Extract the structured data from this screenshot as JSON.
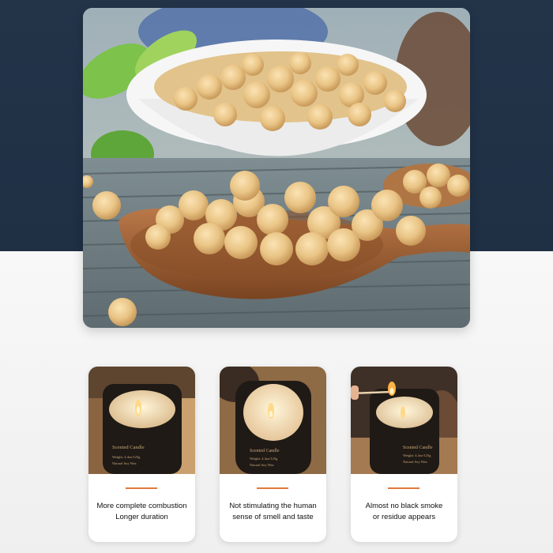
{
  "hero": {
    "image": "soybeans-in-bowl-and-wooden-spoon-photo"
  },
  "features": [
    {
      "image": "lit-candle-jar-photo",
      "jar_label_lines": [
        "Scented Candle",
        "Weight: 4.4oz/125g",
        "Natural Soy Wax"
      ],
      "lines": [
        "More complete combustion",
        "Longer duration"
      ]
    },
    {
      "image": "lit-candle-jar-top-view-photo",
      "jar_label_lines": [
        "Scented Candle",
        "Weight: 4.4oz/125g",
        "Natural Soy Wax"
      ],
      "lines": [
        "Not stimulating the human",
        "sense of smell and taste"
      ]
    },
    {
      "image": "lighting-candle-with-match-photo",
      "jar_label_lines": [
        "Scented Candle",
        "Weight: 4.4oz/125g",
        "Natural Soy Wax"
      ],
      "lines": [
        "Almost no black smoke",
        "or residue appears"
      ]
    }
  ],
  "colors": {
    "top_band": "#233449",
    "accent_line": "#e07a3c",
    "card_bg": "#ffffff"
  }
}
